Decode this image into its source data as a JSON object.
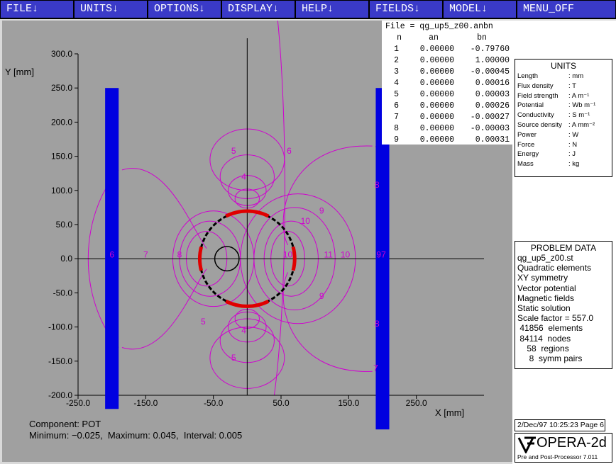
{
  "menu": [
    {
      "label": "FILE↓"
    },
    {
      "label": "UNITS↓"
    },
    {
      "label": "OPTIONS↓"
    },
    {
      "label": "DISPLAY↓"
    },
    {
      "label": "HELP↓"
    },
    {
      "label": "FIELDS↓"
    },
    {
      "label": "MODEL↓"
    },
    {
      "label": "MENU_OFF"
    }
  ],
  "colors": {
    "menu_bg": "#3a3ac8",
    "plot_bg": "#a0a0a0",
    "contour": "#d000d0",
    "coil": "#e00000",
    "iron": "#0000e0"
  },
  "anbn": {
    "title": "File = qg_up5_z00.anbn",
    "headers": {
      "n": "n",
      "an": "an",
      "bn": "bn"
    },
    "rows": [
      {
        "n": "1",
        "an": "0.00000",
        "bn": "-0.79760"
      },
      {
        "n": "2",
        "an": "0.00000",
        "bn": "1.00000"
      },
      {
        "n": "3",
        "an": "0.00000",
        "bn": "-0.00045"
      },
      {
        "n": "4",
        "an": "0.00000",
        "bn": "0.00016"
      },
      {
        "n": "5",
        "an": "0.00000",
        "bn": "0.00003"
      },
      {
        "n": "6",
        "an": "0.00000",
        "bn": "0.00026"
      },
      {
        "n": "7",
        "an": "0.00000",
        "bn": "-0.00027"
      },
      {
        "n": "8",
        "an": "0.00000",
        "bn": "-0.00003"
      },
      {
        "n": "9",
        "an": "0.00000",
        "bn": "0.00031"
      }
    ]
  },
  "chart_data": {
    "type": "contour",
    "xlabel": "X [mm]",
    "ylabel": "Y [mm]",
    "xlim": [
      -250,
      350
    ],
    "ylim": [
      -200,
      300
    ],
    "xticks": [
      "-250.0",
      "-150.0",
      "-50.0",
      "50.0",
      "150.0",
      "250.0"
    ],
    "xtick_values": [
      -250,
      -150,
      -50,
      50,
      150,
      250
    ],
    "yticks": [
      "300.0",
      "250.0",
      "200.0",
      "150.0",
      "100.0",
      "50.0",
      "0.0",
      "-50.0",
      "-100.0",
      "-150.0",
      "-200.0"
    ],
    "ytick_values": [
      300,
      250,
      200,
      150,
      100,
      50,
      0,
      -50,
      -100,
      -150,
      -200
    ],
    "iron_plates": [
      {
        "x0": -210,
        "x1": -190,
        "y0": -220,
        "y1": 250
      },
      {
        "x0": 190,
        "x1": 210,
        "y0": -250,
        "y1": 250
      }
    ],
    "coil_circle": {
      "cx": 0,
      "cy": 0,
      "r": 70
    },
    "inner_circle": {
      "cx": -30,
      "cy": 0,
      "r": 18
    },
    "contour_labels": [
      {
        "text": "5",
        "x": -20,
        "y": 158
      },
      {
        "text": "6",
        "x": 62,
        "y": 158
      },
      {
        "text": "4",
        "x": -5,
        "y": 120
      },
      {
        "text": "9",
        "x": 110,
        "y": 70
      },
      {
        "text": "8",
        "x": 192,
        "y": 108
      },
      {
        "text": "10",
        "x": 86,
        "y": 55
      },
      {
        "text": "6",
        "x": -200,
        "y": 6
      },
      {
        "text": "7",
        "x": -150,
        "y": 6
      },
      {
        "text": "8",
        "x": -100,
        "y": 6
      },
      {
        "text": "10",
        "x": 60,
        "y": 6
      },
      {
        "text": "11",
        "x": 120,
        "y": 6
      },
      {
        "text": "10",
        "x": 145,
        "y": 6
      },
      {
        "text": "97",
        "x": 198,
        "y": 6
      },
      {
        "text": "9",
        "x": 110,
        "y": -55
      },
      {
        "text": "8",
        "x": 192,
        "y": -95
      },
      {
        "text": "5",
        "x": -65,
        "y": -92
      },
      {
        "text": "4",
        "x": -5,
        "y": -105
      },
      {
        "text": "5",
        "x": -20,
        "y": -145
      },
      {
        "text": "7",
        "x": 190,
        "y": -160
      }
    ],
    "component": "POT",
    "minimum": -0.025,
    "maximum": 0.045,
    "interval": 0.005
  },
  "footer": {
    "component": "Component: POT",
    "stats": "Minimum: −0.025,  Maximum: 0.045,  Interval: 0.005"
  },
  "units": {
    "title": "UNITS",
    "rows": [
      {
        "k": "Length",
        "v": ": mm"
      },
      {
        "k": "Flux density",
        "v": ": T"
      },
      {
        "k": "Field strength",
        "v": ": A m⁻¹"
      },
      {
        "k": "Potential",
        "v": ": Wb m⁻¹"
      },
      {
        "k": "Conductivity",
        "v": ": S m⁻¹"
      },
      {
        "k": "Source density",
        "v": ": A mm⁻²"
      },
      {
        "k": "Power",
        "v": ": W"
      },
      {
        "k": "Force",
        "v": ": N"
      },
      {
        "k": "Energy",
        "v": ": J"
      },
      {
        "k": "Mass",
        "v": ": kg"
      }
    ]
  },
  "problem": {
    "title": "PROBLEM DATA",
    "lines": [
      "qg_up5_z00.st",
      "Quadratic elements",
      "XY symmetry",
      "Vector potential",
      "Magnetic fields",
      "Static solution",
      "Scale factor = 557.0",
      " 41856  elements",
      " 84114  nodes",
      "    58  regions",
      "     8  symm pairs"
    ]
  },
  "date": "2/Dec/97 10:25:23 Page 6",
  "logo": {
    "text": "OPERA-2d",
    "subtitle": "Pre and Post-Processor 7.011"
  }
}
